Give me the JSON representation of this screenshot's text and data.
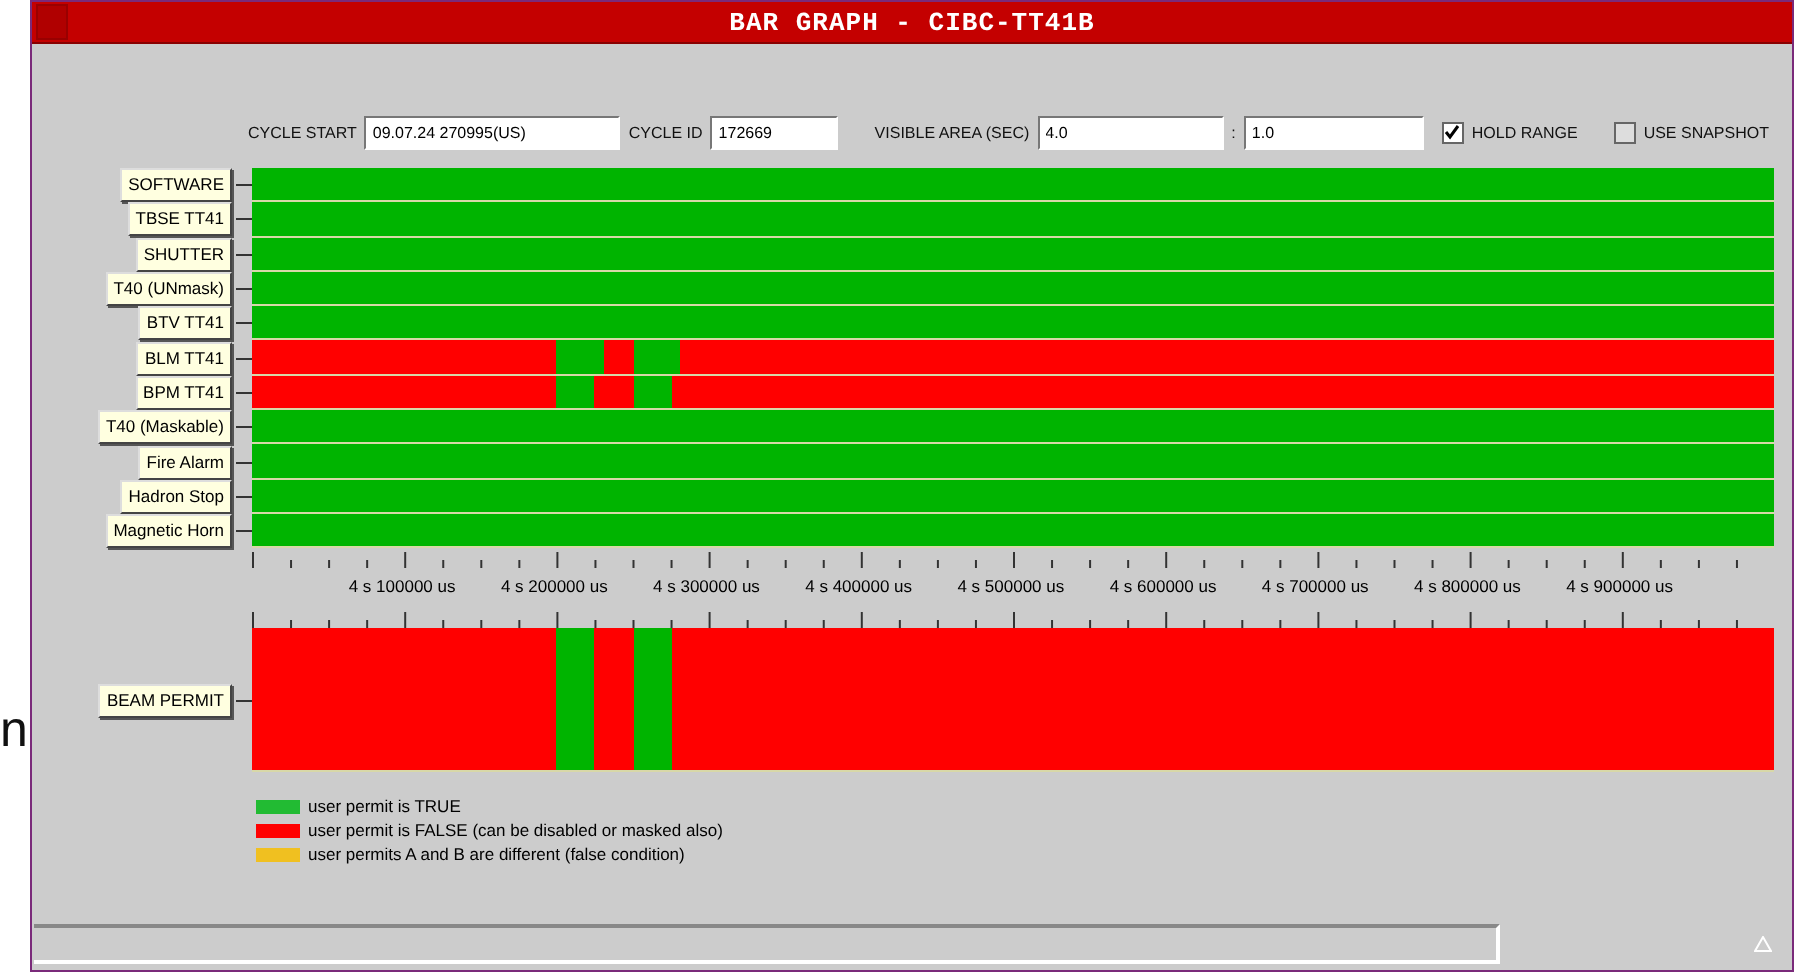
{
  "stray_text": "n",
  "window": {
    "title": "BAR GRAPH - CIBC-TT41B"
  },
  "header": {
    "cycle_start": {
      "label": "CYCLE START",
      "value": "09.07.24 270995(US)"
    },
    "cycle_id": {
      "label": "CYCLE ID",
      "value": "172669"
    },
    "visible_area": {
      "label": "VISIBLE AREA (SEC)",
      "value": "4.0",
      "separator": ":",
      "value_2": "1.0"
    },
    "hold_range": {
      "label": "HOLD RANGE",
      "checked": true
    },
    "use_snapshot": {
      "label": "USE SNAPSHOT",
      "checked": false
    }
  },
  "signals": [
    {
      "name": "SOFTWARE",
      "segments": [
        {
          "kind": "true",
          "level": 1
        }
      ]
    },
    {
      "name": "TBSE TT41",
      "segments": [
        {
          "kind": "true",
          "level": 1
        }
      ]
    },
    {
      "name": "SHUTTER",
      "segments": [
        {
          "kind": "true",
          "level": 1
        }
      ]
    },
    {
      "name": "T40 (UNmask)",
      "segments": [
        {
          "kind": "true",
          "level": 1
        }
      ]
    },
    {
      "name": "BTV TT41",
      "segments": [
        {
          "kind": "true",
          "level": 1
        }
      ]
    },
    {
      "name": "BLM TT41",
      "segments": [
        {
          "kind": "false",
          "level": 0.2
        },
        {
          "kind": "true"
        },
        {
          "kind": "false"
        },
        {
          "kind": "true",
          "level": 0.03
        },
        {
          "kind": "false",
          "level": 0.719
        }
      ]
    },
    {
      "name": "BPM TT41",
      "segments": [
        {
          "kind": "false",
          "level": 0.2
        },
        {
          "kind": "true"
        },
        {
          "kind": "false"
        },
        {
          "kind": "true",
          "level": 0.025
        },
        {
          "kind": "false",
          "level": 0.724
        }
      ]
    },
    {
      "name": "T40 (Maskable)",
      "segments": [
        {
          "kind": "true",
          "level": 1
        }
      ]
    },
    {
      "name": "Fire Alarm",
      "segments": [
        {
          "kind": "true",
          "level": 1
        }
      ]
    },
    {
      "name": "Hadron Stop",
      "segments": [
        {
          "kind": "true",
          "level": 1
        }
      ]
    },
    {
      "name": "Magnetic Horn",
      "segments": [
        {
          "kind": "true",
          "level": 1
        }
      ]
    }
  ],
  "time_axis": [
    "4 s 100000 us",
    "4 s 200000 us",
    "4 s 300000 us",
    "4 s 400000 us",
    "4 s 500000 us",
    "4 s 600000 us",
    "4 s 700000 us",
    "4 s 800000 us",
    "4 s 900000 us"
  ],
  "beam_permit": {
    "name": "BEAM PERMIT",
    "segments": [
      {
        "kind": "false",
        "level": 0.2
      },
      {
        "kind": "true"
      },
      {
        "kind": "false"
      },
      {
        "kind": "true",
        "level": 0.025
      },
      {
        "kind": "false",
        "level": 0.725
      }
    ]
  },
  "legend": [
    {
      "color": "#22bb33",
      "text": "user permit is TRUE"
    },
    {
      "color": "#ff0000",
      "text": "user permit is FALSE (can be disabled or masked also)"
    },
    {
      "color": "#f0c020",
      "text": "user permits A and B are different (false condition)"
    }
  ]
}
